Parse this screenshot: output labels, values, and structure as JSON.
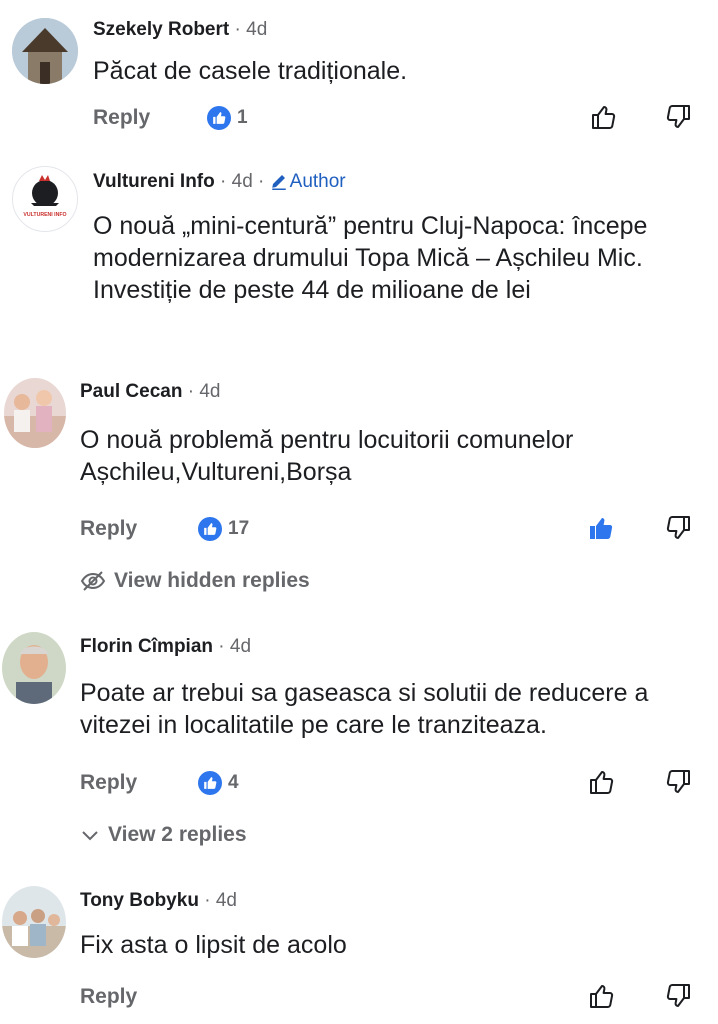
{
  "colors": {
    "accent": "#2d76ed",
    "author": "#1f5fbf",
    "muted": "#65676b",
    "text": "#1c1e21"
  },
  "comments": [
    {
      "name": "Szekely Robert",
      "time": "4d",
      "text": "Păcat de casele tradiționale.",
      "reply": "Reply",
      "reactions": "1",
      "liked": false
    },
    {
      "name": "Vultureni Info",
      "time": "4d",
      "author_badge": "Author",
      "avatar_text": "VULTURENI INFO",
      "text": "O nouă „mini-centură” pentru Cluj-Napoca: începe modernizarea drumului Topa Mică – Așchileu Mic. Investiție de peste 44 de milioane de lei"
    },
    {
      "name": "Paul Cecan",
      "time": "4d",
      "text": "O nouă problemă pentru locuitorii comunelor Așchileu,Vultureni,Borșa",
      "reply": "Reply",
      "reactions": "17",
      "liked": true,
      "thread_link": "View hidden replies"
    },
    {
      "name": "Florin Cîmpian",
      "time": "4d",
      "text": "Poate ar trebui sa gaseasca si solutii de reducere a vitezei in localitatile pe care le tranziteaza.",
      "reply": "Reply",
      "reactions": "4",
      "liked": false,
      "thread_link": "View 2 replies"
    },
    {
      "name": "Tony Bobyku",
      "time": "4d",
      "text": "Fix asta o lipsit de acolo",
      "reply": "Reply",
      "liked": false
    }
  ]
}
